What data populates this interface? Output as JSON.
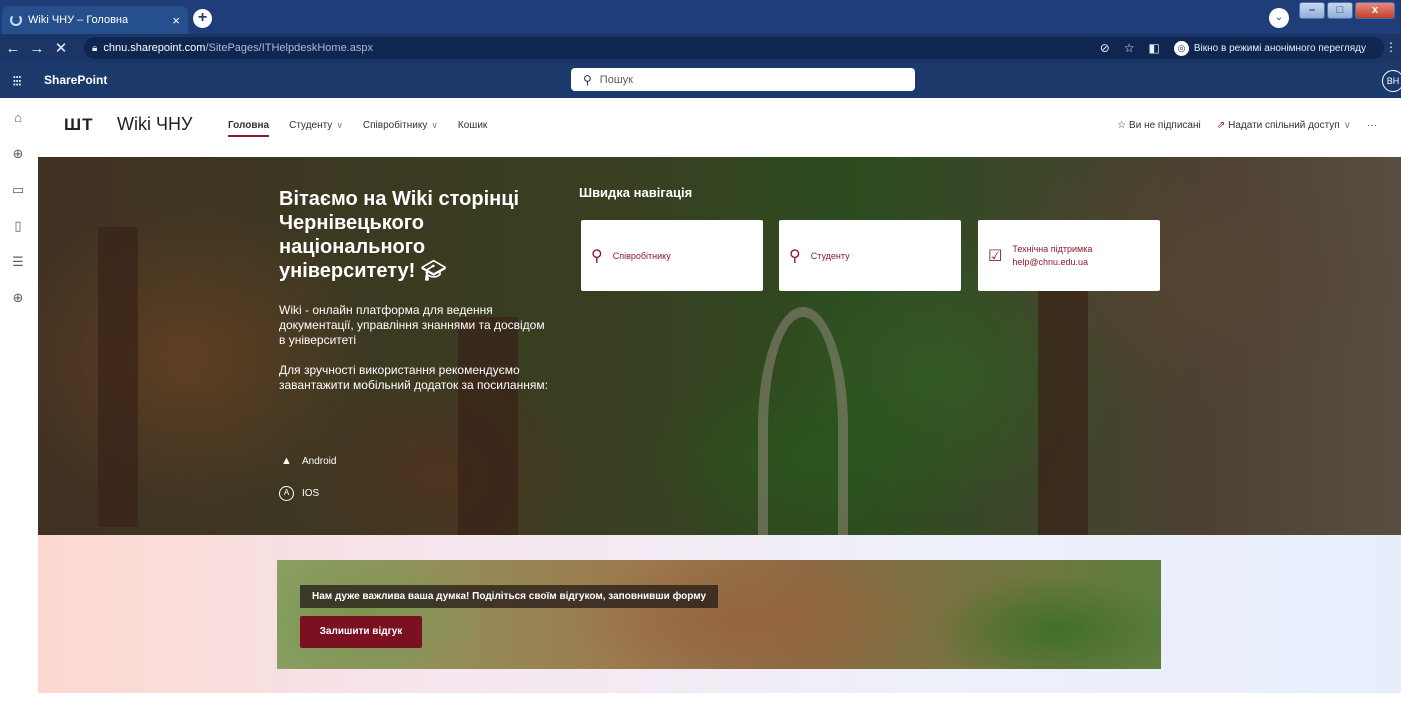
{
  "browser": {
    "tab_title": "Wiki ЧНУ – Головна",
    "url_host": "chnu.sharepoint.com",
    "url_path": "/SitePages/ITHelpdeskHome.aspx",
    "incognito_label": "Вікно в режимі анонімного перегляду"
  },
  "suitebar": {
    "brand": "SharePoint",
    "search_placeholder": "Пошук",
    "avatar_initials": "ВН"
  },
  "site": {
    "logo_text": "ШТ",
    "title": "Wiki ЧНУ",
    "nav": [
      {
        "label": "Головна",
        "active": true
      },
      {
        "label": "Студенту",
        "has_dropdown": true
      },
      {
        "label": "Співробітнику",
        "has_dropdown": true
      },
      {
        "label": "Кошик"
      }
    ],
    "actions": {
      "follow": "Ви не підписані",
      "share": "Надати спільний доступ"
    }
  },
  "hero": {
    "heading": "Вітаємо на Wiki сторінці Чернівецького національного університету!",
    "description": "Wiki - онлайн платформа для ведення документації, управління знаннями та досвідом в університеті",
    "app_hint": "Для зручності використання рекомендуємо завантажити мобільний додаток за посиланням:",
    "android_label": "Android",
    "ios_label": "IOS",
    "quick_nav_title": "Швидка навігація",
    "cards": [
      {
        "label": "Співробітнику"
      },
      {
        "label": "Студенту"
      },
      {
        "label": "Технічна підтримка",
        "sub": "help@chnu.edu.ua"
      }
    ]
  },
  "feedback": {
    "text": "Нам дуже важлива ваша думка! Поділіться своїм відгуком, заповнивши форму",
    "button": "Залишити відгук"
  },
  "colors": {
    "accent": "#8a1c2a",
    "suitebar": "#1b3a6b",
    "button": "#7a1020"
  }
}
